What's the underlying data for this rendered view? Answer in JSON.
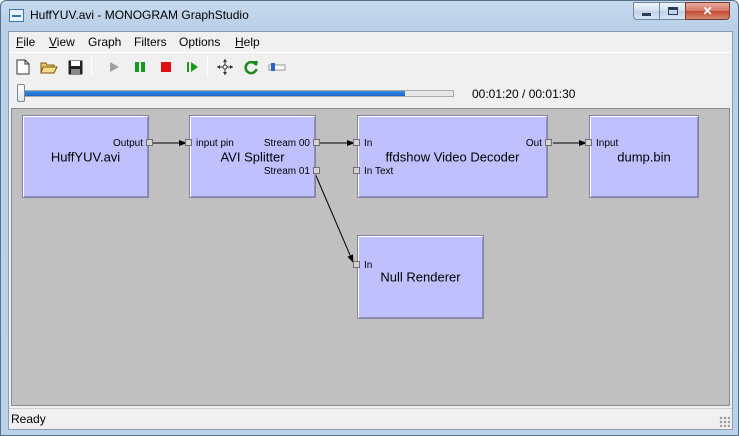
{
  "window": {
    "title": "HuffYUV.avi - MONOGRAM GraphStudio",
    "close_glyph": "✕"
  },
  "menu": {
    "items": [
      {
        "first": "F",
        "rest": "ile"
      },
      {
        "first": "V",
        "rest": "iew"
      },
      {
        "first": "",
        "rest": "Graph"
      },
      {
        "first": "",
        "rest": "Filters"
      },
      {
        "first": "",
        "rest": "Options"
      },
      {
        "first": "H",
        "rest": "elp"
      }
    ]
  },
  "toolbar": {
    "icons": [
      "new-file-icon",
      "open-folder-icon",
      "save-icon",
      "play-icon",
      "pause-icon",
      "stop-icon",
      "step-frame-icon",
      "arrange-icon",
      "refresh-icon",
      "seek-options-icon"
    ]
  },
  "seek": {
    "time_text": "00:01:20 / 00:01:30",
    "progress": 0.889
  },
  "graph": {
    "filters": [
      {
        "name": "HuffYUV.avi",
        "pins_out": [
          "Output"
        ],
        "pins_in": []
      },
      {
        "name": "AVI Splitter",
        "pins_in": [
          "input pin"
        ],
        "pins_out": [
          "Stream 00",
          "Stream 01"
        ]
      },
      {
        "name": "ffdshow Video Decoder",
        "pins_in": [
          "In",
          "In Text"
        ],
        "pins_out": [
          "Out"
        ]
      },
      {
        "name": "dump.bin",
        "pins_in": [
          "Input"
        ],
        "pins_out": []
      },
      {
        "name": "Null Renderer",
        "pins_in": [
          "In"
        ],
        "pins_out": []
      }
    ]
  },
  "status": {
    "text": "Ready"
  },
  "colors": {
    "filter_fill": "#c0c0ff",
    "canvas": "#c0c0c0",
    "play_disabled": "#a0a0a0",
    "pause": "#1a9a1a",
    "stop": "#e01010"
  }
}
